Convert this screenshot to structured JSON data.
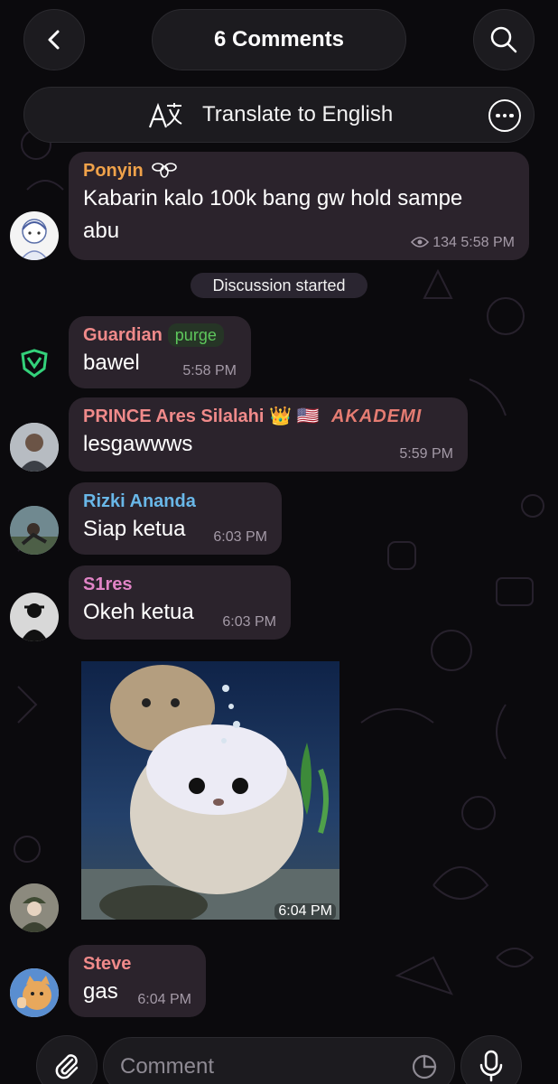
{
  "header": {
    "title": "6 Comments",
    "back_icon": "chevron-left-icon",
    "search_icon": "search-icon"
  },
  "translate": {
    "label": "Translate to English",
    "icon": "translate-icon",
    "more_icon": "more-icon"
  },
  "service": {
    "discussion_started": "Discussion started"
  },
  "messages": [
    {
      "name": "Ponyin",
      "name_color": "#f0a24a",
      "badge_icon": "fly-icon",
      "text_line1": "Kabarin kalo 100k bang gw hold sampe",
      "text_line2": "abu",
      "views": "134",
      "time": "5:58 PM"
    },
    {
      "name": "Guardian",
      "name_color": "#f08a8a",
      "tag": "purge",
      "text": "bawel",
      "time": "5:58 PM"
    },
    {
      "name": "PRINCE Ares Silalahi",
      "name_color": "#f08a8a",
      "emoji": "👑 🇺🇸",
      "suffix": "AKADEMI",
      "text": "lesgawwws",
      "time": "5:59 PM"
    },
    {
      "name": "Rizki Ananda",
      "name_color": "#69b7e8",
      "text": "Siap ketua",
      "time": "6:03 PM"
    },
    {
      "name": "S1res",
      "name_color": "#e184c6",
      "text": "Okeh ketua",
      "time": "6:03 PM"
    },
    {
      "media": "gif-image",
      "time": "6:04 PM"
    },
    {
      "name": "Steve",
      "name_color": "#f08a8a",
      "text": "gas",
      "time": "6:04 PM"
    }
  ],
  "composer": {
    "placeholder": "Comment",
    "attach_icon": "paperclip-icon",
    "sticker_icon": "sticker-icon",
    "mic_icon": "microphone-icon"
  }
}
